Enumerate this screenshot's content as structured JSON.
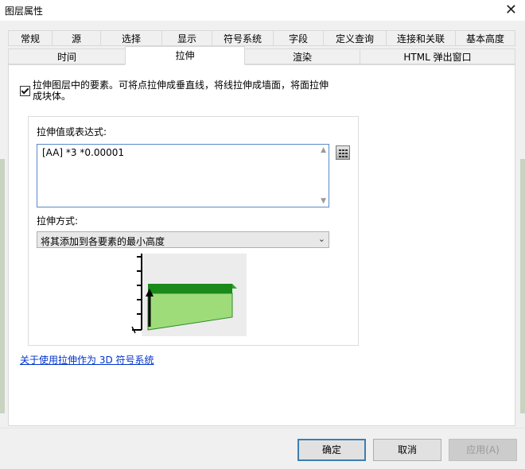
{
  "window": {
    "title": "图层属性"
  },
  "tabs_row1": [
    "常规",
    "源",
    "选择",
    "显示",
    "符号系统",
    "字段",
    "定义查询",
    "连接和关联",
    "基本高度"
  ],
  "tabs_row2": [
    "时间",
    "拉伸",
    "渲染",
    "HTML 弹出窗口"
  ],
  "active_tab": "拉伸",
  "extrusion": {
    "checkbox_label": "拉伸图层中的要素。可将点拉伸成垂直线，将线拉伸成墙面，将面拉伸成块体。",
    "checked": true,
    "value_label": "拉伸值或表达式:",
    "expression": "[AA] *3 *0.00001",
    "method_label": "拉伸方式:",
    "method_value": "将其添加到各要素的最小高度",
    "help_link": "关于使用拉伸作为 3D 符号系统"
  },
  "buttons": {
    "ok": "确定",
    "cancel": "取消",
    "apply": "应用(A)"
  },
  "colors": {
    "accent": "#3c7fb1",
    "link": "#0033cc",
    "extrude_dark": "#1a8a1a",
    "extrude_light": "#9edc7a"
  },
  "icons": {
    "close": "close-icon",
    "calculator": "calculator-icon",
    "dropdown": "chevron-down-icon"
  }
}
